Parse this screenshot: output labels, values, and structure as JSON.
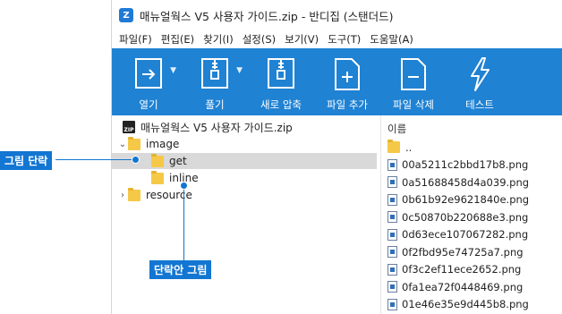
{
  "window": {
    "title": "매뉴얼웍스 V5 사용자 가이드.zip - 반디집 (스탠더드)",
    "logo_text": "Z"
  },
  "menu": [
    "파일(F)",
    "편집(E)",
    "찾기(I)",
    "설정(S)",
    "보기(V)",
    "도구(T)",
    "도움말(A)"
  ],
  "toolbar": {
    "open": "열기",
    "extract": "풀기",
    "new_archive": "새로 압축",
    "add_file": "파일 추가",
    "delete_file": "파일 삭제",
    "test": "테스트"
  },
  "tree": {
    "root": "매뉴얼웍스 V5 사용자 가이드.zip",
    "root_badge": "ZIP",
    "image": "image",
    "get": "get",
    "inline": "inline",
    "resource": "resource"
  },
  "list": {
    "header": "이름",
    "parent": "..",
    "files": [
      "00a5211c2bbd17b8.png",
      "0a51688458d4a039.png",
      "0b61b92e9621840e.png",
      "0c50870b220688e3.png",
      "0d63ece107067282.png",
      "0f2fbd95e74725a7.png",
      "0f3c2ef11ece2652.png",
      "0fa1ea72f0448469.png",
      "01e46e35e9d445b8.png"
    ]
  },
  "annotations": {
    "paragraph_image": "그림 단락",
    "inline_image": "단락안 그림"
  },
  "colors": {
    "toolbar": "#1f82d3",
    "callout": "#1276d2",
    "folder": "#f5c848",
    "selection": "#d9d9d9"
  }
}
